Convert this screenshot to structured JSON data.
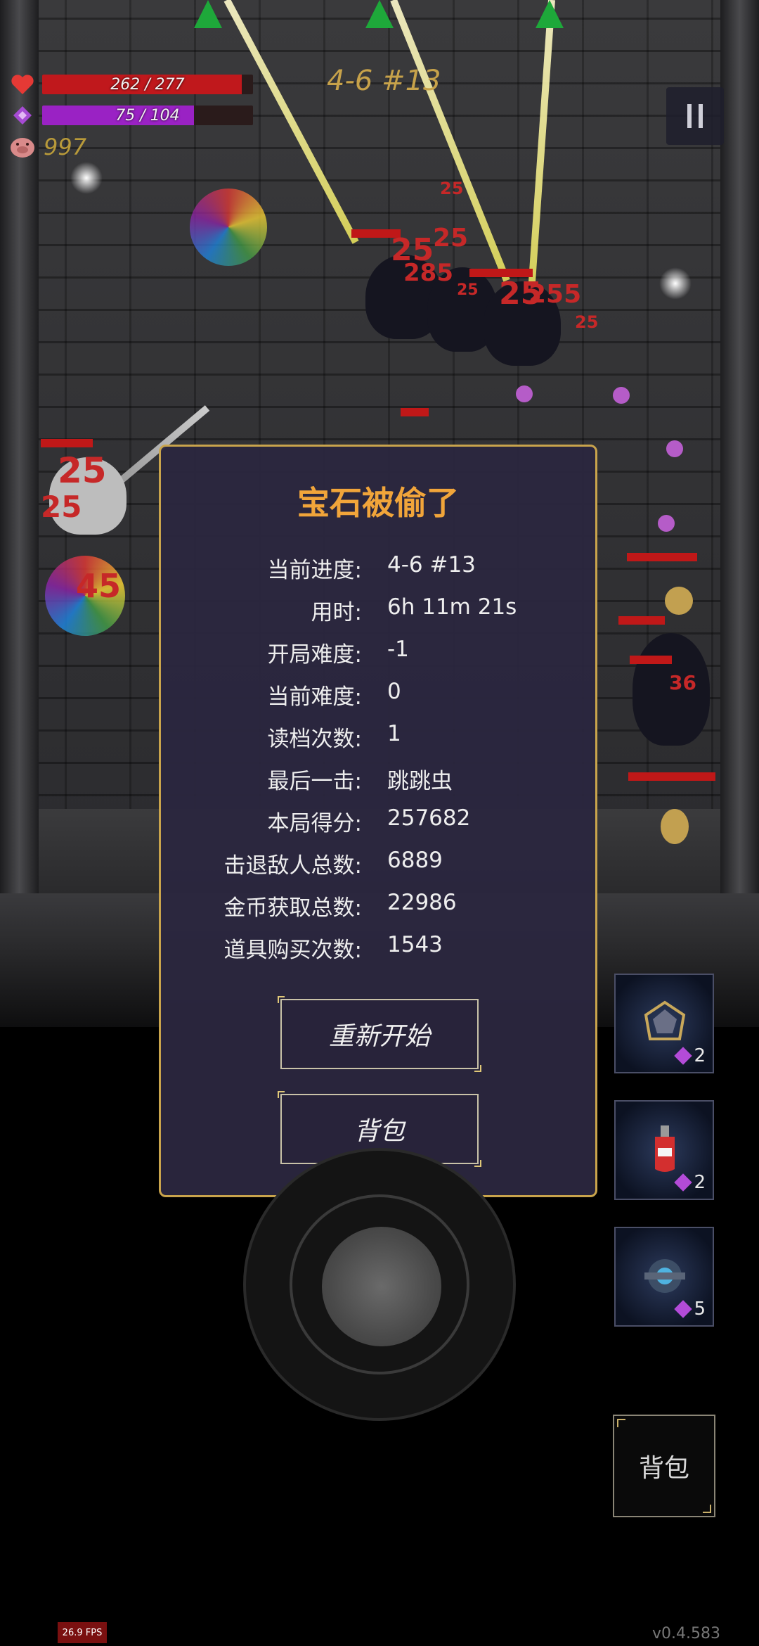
{
  "hud": {
    "hp_text": "262 / 277",
    "hp_fraction": 0.946,
    "mana_text": "75 / 104",
    "mana_fraction": 0.721,
    "coins": "997",
    "level_tag": "4-6 #13",
    "colors": {
      "hp": "#c0181c",
      "mana": "#9a22c4",
      "coins": "#b89a3a",
      "level": "#c7a24a"
    }
  },
  "arena": {
    "damage_numbers": [
      "25",
      "25",
      "25",
      "285",
      "25",
      "25",
      "255",
      "25",
      "25",
      "25",
      "45",
      "36"
    ]
  },
  "dialog": {
    "title": "宝石被偷了",
    "stats": [
      {
        "label": "当前进度:",
        "value": "4-6 #13"
      },
      {
        "label": "用时:",
        "value": "6h 11m 21s"
      },
      {
        "label": "开局难度:",
        "value": "-1"
      },
      {
        "label": "当前难度:",
        "value": "0"
      },
      {
        "label": "读档次数:",
        "value": "1"
      },
      {
        "label": "最后一击:",
        "value": "跳跳虫"
      },
      {
        "label": "本局得分:",
        "value": "257682"
      },
      {
        "label": "击退敌人总数:",
        "value": "6889"
      },
      {
        "label": "金币获取总数:",
        "value": "22986"
      },
      {
        "label": "道具购买次数:",
        "value": "1543"
      }
    ],
    "restart_label": "重新开始",
    "backpack_label": "背包",
    "colors": {
      "title": "#f1a53a",
      "border": "#c9a44c",
      "background": "#2b263e"
    }
  },
  "item_slots": [
    {
      "icon": "crystal-cage-icon",
      "count": "2"
    },
    {
      "icon": "red-potion-icon",
      "count": "2"
    },
    {
      "icon": "blue-orb-device-icon",
      "count": "5"
    }
  ],
  "bag_button_label": "背包",
  "fps": "26.9 FPS",
  "version": "v0.4.583"
}
